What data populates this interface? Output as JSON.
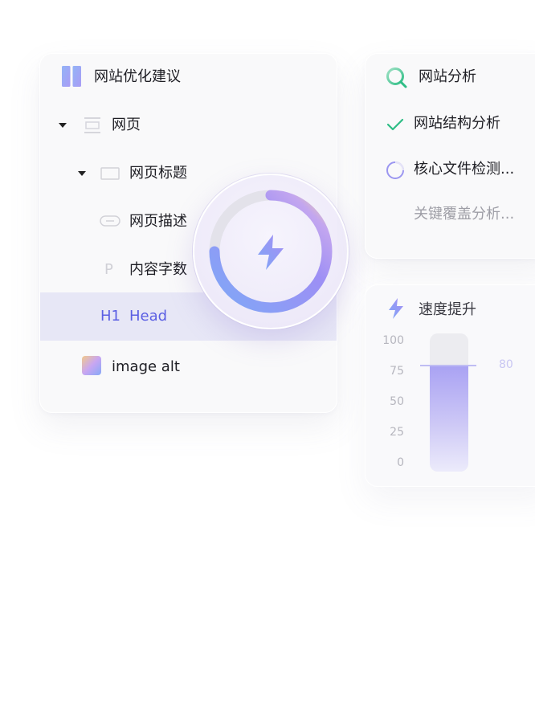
{
  "suggestions": {
    "title": "网站优化建议",
    "tree": {
      "webpage": "网页",
      "page_title": "网页标题",
      "page_description": "网页描述",
      "content_count": "内容字数",
      "h1_tag": "H1",
      "h1_label": "Head",
      "image_alt": "image alt",
      "p_tag": "P"
    }
  },
  "analysis": {
    "title": "网站分析",
    "items": [
      {
        "label": "网站结构分析",
        "status": "done"
      },
      {
        "label": "核心文件检测...",
        "status": "in-progress"
      },
      {
        "label": "关键覆盖分析...",
        "status": "pending"
      }
    ]
  },
  "speed": {
    "title": "速度提升",
    "axis_ticks": [
      "100",
      "75",
      "50",
      "25",
      "0"
    ],
    "value": 80,
    "value_label": "80",
    "max": 100
  },
  "colors": {
    "accent": "#6b6ef0",
    "success": "#2ebd85",
    "highlight_row": "#e7e7f6",
    "gradient_start": "#7da4f5",
    "gradient_end": "#b08cf4"
  },
  "icons": {
    "fab": "lightning-icon",
    "speed": "lightning-icon",
    "analysis": "magnifier-icon",
    "done": "check-icon",
    "loading": "spinner-icon"
  }
}
